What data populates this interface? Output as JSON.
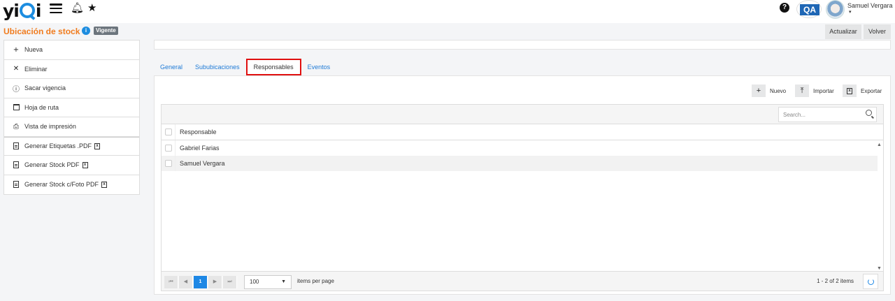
{
  "header": {
    "logo_text": "yiQi",
    "help_label": "?",
    "qa_badge": "QA",
    "user_name": "Samuel Vergara",
    "user_caret": "▾"
  },
  "page": {
    "title": "Ubicación de stock",
    "info_label": "i",
    "status": "Vigente",
    "actions": {
      "update": "Actualizar",
      "back": "Volver"
    }
  },
  "sidebar": {
    "items": [
      {
        "label": "Nueva",
        "icon": "plus-icon",
        "glyph": "+"
      },
      {
        "label": "Eliminar",
        "icon": "close-icon",
        "glyph": "✕"
      },
      {
        "label": "Sacar vigencia",
        "icon": "alert-circle-icon",
        "glyph": "ⓘ"
      },
      {
        "label": "Hoja de ruta",
        "icon": "calendar-icon",
        "glyph": ""
      },
      {
        "label": "Vista de impresión",
        "icon": "printer-icon",
        "glyph": "⎙"
      },
      {
        "label": "Generar Etiquetas .PDF",
        "icon": "pdf-icon",
        "glyph": ""
      },
      {
        "label": "Generar Stock PDF",
        "icon": "pdf-icon",
        "glyph": ""
      },
      {
        "label": "Generar Stock c/Foto PDF",
        "icon": "pdf-icon",
        "glyph": ""
      }
    ],
    "file_marker": "x"
  },
  "tabs": [
    {
      "label": "General",
      "active": false
    },
    {
      "label": "Sububicaciones",
      "active": false
    },
    {
      "label": "Responsables",
      "active": true
    },
    {
      "label": "Eventos",
      "active": false
    }
  ],
  "toolbar": {
    "new_label": "Nuevo",
    "new_glyph": "+",
    "import_label": "Importar",
    "import_glyph": "⤒",
    "export_label": "Exportar",
    "export_glyph": "x"
  },
  "grid": {
    "search_placeholder": "Search...",
    "column_header": "Responsable",
    "rows": [
      "Gabriel Farias",
      "Samuel Vergara"
    ],
    "scroll_up": "▲",
    "scroll_down": "▼"
  },
  "pager": {
    "first": "⏮",
    "prev": "◀",
    "current_page": "1",
    "next": "▶",
    "last": "⏭",
    "page_size": "100",
    "page_size_caret": "▼",
    "per_page_label": "items per page",
    "info": "1 - 2 of 2 items"
  },
  "colors": {
    "accent_orange": "#f07c1f",
    "link_blue": "#1e7ad6",
    "active_tab_border": "#e01010",
    "pager_active": "#1e88e5"
  }
}
